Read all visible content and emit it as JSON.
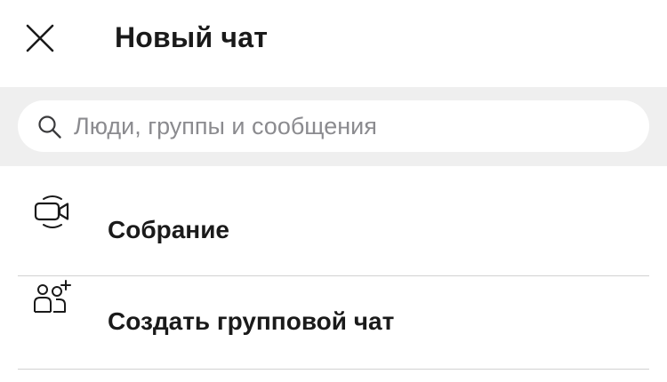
{
  "header": {
    "title": "Новый чат",
    "close_icon": "close-icon"
  },
  "search": {
    "placeholder": "Люди, группы и сообщения",
    "value": "",
    "icon": "search-icon"
  },
  "menu": {
    "items": [
      {
        "label": "Собрание",
        "icon": "video-call-icon"
      },
      {
        "label": "Создать групповой чат",
        "icon": "add-group-icon"
      }
    ]
  },
  "colors": {
    "background": "#ffffff",
    "search_band": "#efefef",
    "text": "#1a1a1a",
    "placeholder": "#8b8b8f",
    "divider": "#d2d2d2"
  }
}
